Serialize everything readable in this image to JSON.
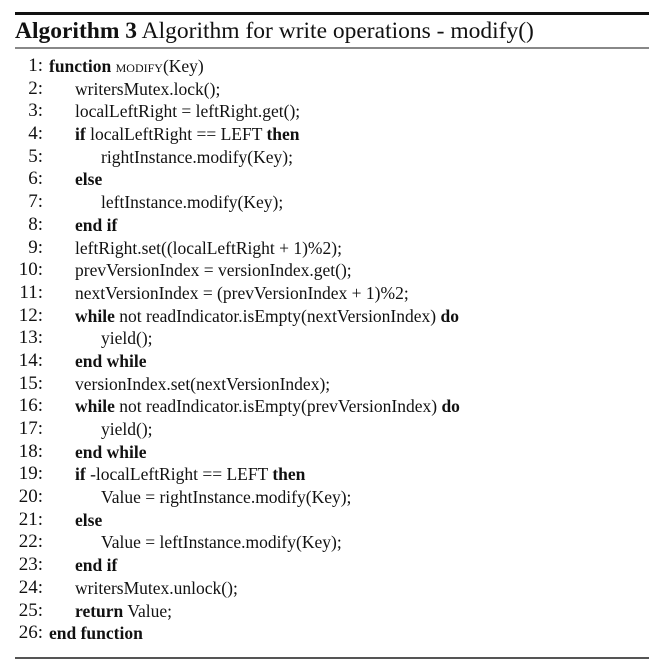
{
  "algorithm": {
    "label": "Algorithm 3",
    "title": "Algorithm for write operations - modify()",
    "lines": [
      {
        "num": "1:",
        "indent": 0,
        "parts": [
          {
            "t": "function",
            "s": "kw"
          },
          {
            "t": " "
          },
          {
            "t": "modify",
            "s": "sc"
          },
          {
            "t": "(Key)"
          }
        ]
      },
      {
        "num": "2:",
        "indent": 1,
        "parts": [
          {
            "t": "writersMutex.lock();"
          }
        ]
      },
      {
        "num": "3:",
        "indent": 1,
        "parts": [
          {
            "t": "localLeftRight = leftRight.get();"
          }
        ]
      },
      {
        "num": "4:",
        "indent": 1,
        "parts": [
          {
            "t": "if",
            "s": "kw"
          },
          {
            "t": " localLeftRight == LEFT "
          },
          {
            "t": "then",
            "s": "kw"
          }
        ]
      },
      {
        "num": "5:",
        "indent": 2,
        "parts": [
          {
            "t": "rightInstance.modify(Key);"
          }
        ]
      },
      {
        "num": "6:",
        "indent": 1,
        "parts": [
          {
            "t": "else",
            "s": "kw"
          }
        ]
      },
      {
        "num": "7:",
        "indent": 2,
        "parts": [
          {
            "t": "leftInstance.modify(Key);"
          }
        ]
      },
      {
        "num": "8:",
        "indent": 1,
        "parts": [
          {
            "t": "end if",
            "s": "kw"
          }
        ]
      },
      {
        "num": "9:",
        "indent": 1,
        "parts": [
          {
            "t": "leftRight.set((localLeftRight + 1)%2);"
          }
        ]
      },
      {
        "num": "10:",
        "indent": 1,
        "parts": [
          {
            "t": "prevVersionIndex = versionIndex.get();"
          }
        ]
      },
      {
        "num": "11:",
        "indent": 1,
        "parts": [
          {
            "t": "nextVersionIndex = (prevVersionIndex + 1)%2;"
          }
        ]
      },
      {
        "num": "12:",
        "indent": 1,
        "parts": [
          {
            "t": "while",
            "s": "kw"
          },
          {
            "t": " not readIndicator.isEmpty(nextVersionIndex) "
          },
          {
            "t": "do",
            "s": "kw"
          }
        ]
      },
      {
        "num": "13:",
        "indent": 2,
        "parts": [
          {
            "t": "yield();"
          }
        ]
      },
      {
        "num": "14:",
        "indent": 1,
        "parts": [
          {
            "t": "end while",
            "s": "kw"
          }
        ]
      },
      {
        "num": "15:",
        "indent": 1,
        "parts": [
          {
            "t": "versionIndex.set(nextVersionIndex);"
          }
        ]
      },
      {
        "num": "16:",
        "indent": 1,
        "parts": [
          {
            "t": "while",
            "s": "kw"
          },
          {
            "t": " not readIndicator.isEmpty(prevVersionIndex) "
          },
          {
            "t": "do",
            "s": "kw"
          }
        ]
      },
      {
        "num": "17:",
        "indent": 2,
        "parts": [
          {
            "t": "yield();"
          }
        ]
      },
      {
        "num": "18:",
        "indent": 1,
        "parts": [
          {
            "t": "end while",
            "s": "kw"
          }
        ]
      },
      {
        "num": "19:",
        "indent": 1,
        "parts": [
          {
            "t": "if",
            "s": "kw"
          },
          {
            "t": " -localLeftRight == LEFT "
          },
          {
            "t": "then",
            "s": "kw"
          }
        ]
      },
      {
        "num": "20:",
        "indent": 2,
        "parts": [
          {
            "t": "Value = rightInstance.modify(Key);"
          }
        ]
      },
      {
        "num": "21:",
        "indent": 1,
        "parts": [
          {
            "t": "else",
            "s": "kw"
          }
        ]
      },
      {
        "num": "22:",
        "indent": 2,
        "parts": [
          {
            "t": "Value = leftInstance.modify(Key);"
          }
        ]
      },
      {
        "num": "23:",
        "indent": 1,
        "parts": [
          {
            "t": "end if",
            "s": "kw"
          }
        ]
      },
      {
        "num": "24:",
        "indent": 1,
        "parts": [
          {
            "t": "writersMutex.unlock();"
          }
        ]
      },
      {
        "num": "25:",
        "indent": 1,
        "parts": [
          {
            "t": "return",
            "s": "kw"
          },
          {
            "t": " Value;"
          }
        ]
      },
      {
        "num": "26:",
        "indent": 0,
        "parts": [
          {
            "t": "end function",
            "s": "kw"
          }
        ]
      }
    ]
  }
}
